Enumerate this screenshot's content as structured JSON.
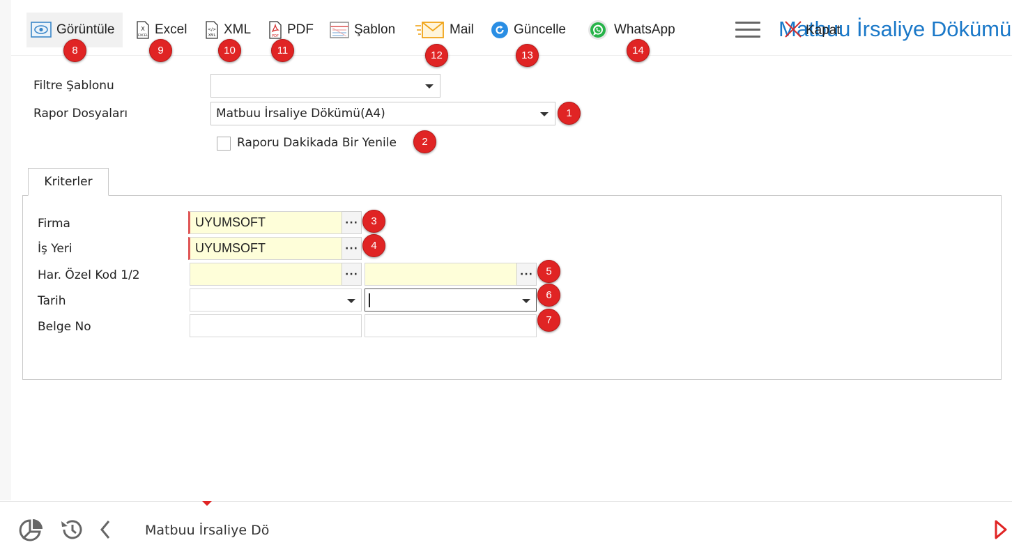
{
  "toolbar": {
    "items": [
      {
        "label": "Görüntüle",
        "icon": "eye-icon",
        "badge": "8"
      },
      {
        "label": "Excel",
        "icon": "excel-file-icon",
        "badge": "9"
      },
      {
        "label": "XML",
        "icon": "xml-file-icon",
        "badge": "10"
      },
      {
        "label": "PDF",
        "icon": "pdf-file-icon",
        "badge": "11"
      },
      {
        "label": "Şablon",
        "icon": "template-icon",
        "badge": ""
      },
      {
        "label": "Mail",
        "icon": "mail-icon",
        "badge": "12"
      },
      {
        "label": "Güncelle",
        "icon": "refresh-icon",
        "badge": "13"
      },
      {
        "label": "WhatsApp",
        "icon": "whatsapp-icon",
        "badge": "14"
      }
    ],
    "page_title": "Matbuu İrsaliye Dökümü",
    "close_label": "Kapat"
  },
  "form": {
    "filter_template_label": "Filtre Şablonu",
    "filter_template_value": "",
    "report_files_label": "Rapor Dosyaları",
    "report_files_value": "Matbuu İrsaliye Dökümü(A4)",
    "report_files_badge": "1",
    "refresh_checkbox_label": "Raporu Dakikada Bir Yenile",
    "refresh_checkbox_checked": false,
    "refresh_checkbox_badge": "2"
  },
  "tabs": [
    {
      "label": "Kriterler"
    }
  ],
  "criteria": {
    "firma": {
      "label": "Firma",
      "value": "UYUMSOFT",
      "badge": "3"
    },
    "is_yeri": {
      "label": "İş Yeri",
      "value": "UYUMSOFT",
      "badge": "4"
    },
    "ozel_kod": {
      "label": "Har. Özel Kod 1/2",
      "value1": "",
      "value2": "",
      "badge": "5"
    },
    "tarih": {
      "label": "Tarih",
      "value1": "",
      "value2": "",
      "badge": "6"
    },
    "belge_no": {
      "label": "Belge No",
      "value1": "",
      "value2": "",
      "badge": "7"
    }
  },
  "footer": {
    "title": "Matbuu İrsaliye Dö",
    "icons": [
      "pie-chart-icon",
      "history-icon",
      "chevron-left-icon",
      "play-right-icon"
    ]
  },
  "colors": {
    "badge": "#e02424",
    "title_blue": "#1a78c8",
    "required_field_bg": "#fefed9",
    "required_marker": "#e05656"
  }
}
